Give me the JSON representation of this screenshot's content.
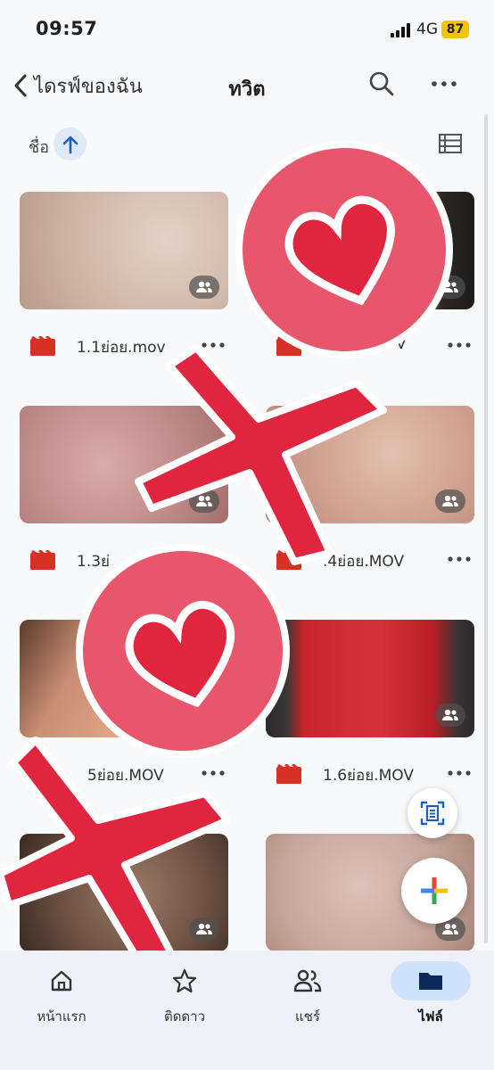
{
  "status": {
    "time": "09:57",
    "network": "4G",
    "battery": "87"
  },
  "header": {
    "back_label": "ไดรฟ์ของฉัน",
    "title": "ทวิต"
  },
  "sort": {
    "label": "ชื่อ"
  },
  "files": [
    {
      "name": "1.1ย่อย.mov",
      "thumb_color": "#d8c4b6"
    },
    {
      "name": "V",
      "thumb_color": "#c9a494"
    },
    {
      "name": "1.3ย่",
      "thumb_color": "#c59a96"
    },
    {
      "name": ".4ย่อย.MOV",
      "thumb_color": "#d6a99a"
    },
    {
      "name": "5ย่อย.MOV",
      "thumb_color": "#c98e74"
    },
    {
      "name": "1.6ย่อย.MOV",
      "thumb_color": "#c8262c"
    },
    {
      "name": "",
      "thumb_color": "#7a6255"
    },
    {
      "name": "",
      "thumb_color": "#c9aea4"
    }
  ],
  "nav": [
    {
      "label": "หน้าแรก",
      "icon": "home-icon",
      "active": false
    },
    {
      "label": "ติดดาว",
      "icon": "star-icon",
      "active": false
    },
    {
      "label": "แชร์",
      "icon": "people-icon",
      "active": false
    },
    {
      "label": "ไฟล์",
      "icon": "folder-icon",
      "active": true
    }
  ],
  "colors": {
    "accent": "#1a73e8",
    "sticker_pink": "#e8566c",
    "sticker_red": "#e0263e",
    "file_icon_red": "#d93025"
  }
}
